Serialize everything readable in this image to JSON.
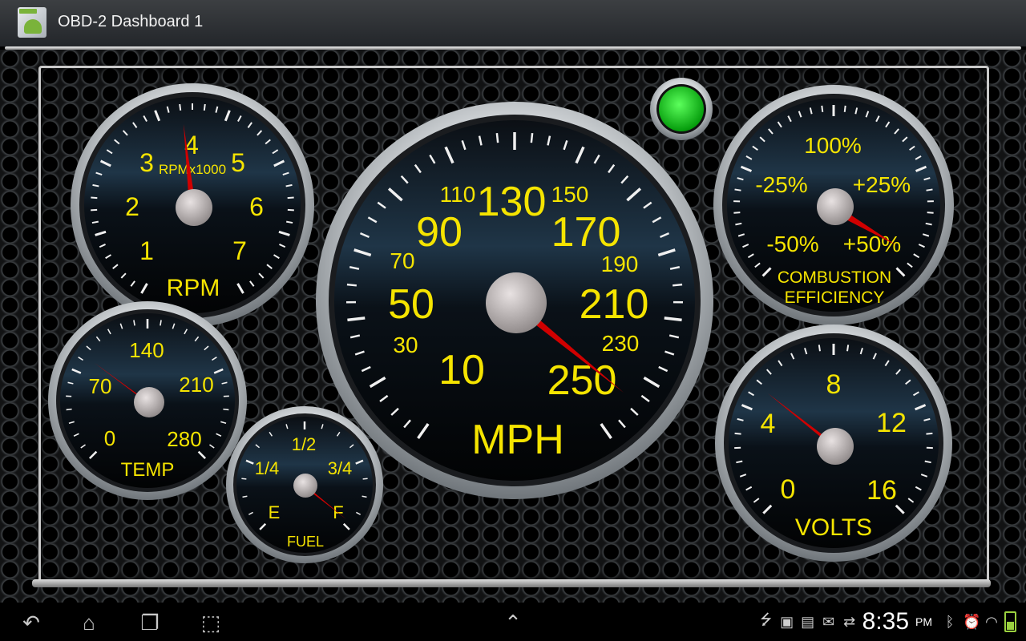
{
  "app": {
    "title": "OBD-2 Dashboard 1",
    "icon": "android-app-icon"
  },
  "indicator": {
    "status": "connected",
    "color": "#10c818"
  },
  "gauges": {
    "rpm": {
      "label": "RPM",
      "sublabel": "RPMx1000",
      "ticks": [
        "1",
        "2",
        "3",
        "4",
        "5",
        "6",
        "7"
      ],
      "value": 4.0
    },
    "speed": {
      "label": "MPH",
      "major_ticks": [
        "10",
        "50",
        "90",
        "130",
        "170",
        "210",
        "250"
      ],
      "minor_ticks": [
        "30",
        "70",
        "110",
        "150",
        "190",
        "230"
      ],
      "value": 250
    },
    "efficiency": {
      "label_line1": "COMBUSTION",
      "label_line2": "EFFICIENCY",
      "ticks": [
        "-50%",
        "-25%",
        "100%",
        "+25%",
        "+50%"
      ],
      "value_pct": 50
    },
    "temp": {
      "label": "TEMP",
      "ticks": [
        "0",
        "70",
        "140",
        "210",
        "280"
      ],
      "value": 65
    },
    "fuel": {
      "label": "FUEL",
      "ticks": [
        "E",
        "1/4",
        "1/2",
        "3/4",
        "F"
      ],
      "value_fraction": 1.0
    },
    "volts": {
      "label": "VOLTS",
      "ticks": [
        "0",
        "4",
        "8",
        "12",
        "16"
      ],
      "value": 4.5
    }
  },
  "navbar": {
    "back_icon": "back-icon",
    "home_icon": "home-icon",
    "recent_icon": "recent-apps-icon",
    "screenshot_icon": "screenshot-icon",
    "up_icon": "chevron-up-icon"
  },
  "status": {
    "time": "8:35",
    "ampm": "PM"
  },
  "colors": {
    "accent": "#f5e400",
    "needle": "#d00000",
    "face": "#05090e"
  }
}
